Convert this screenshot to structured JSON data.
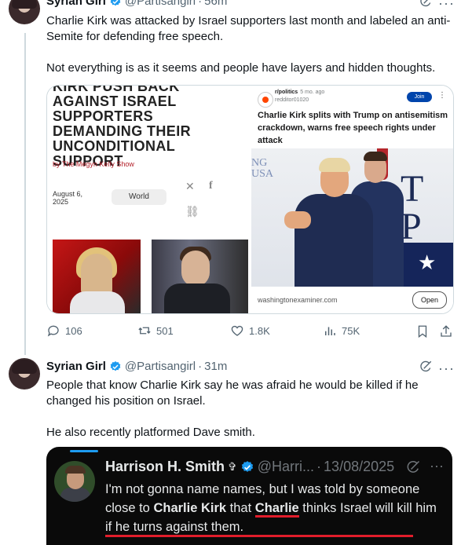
{
  "tweet1": {
    "name": "Syrian Girl",
    "handle": "@Partisangirl",
    "time": "56m",
    "text_line1": "Charlie Kirk was attacked by Israel supporters last month and labeled an anti-Semite for defending free speech.",
    "text_line2": "Not everything is as it seems and people have layers and hidden thoughts.",
    "media_left": {
      "headline": "KIRK PUSH BACK AGAINST ISRAEL SUPPORTERS DEMANDING THEIR UNCONDITIONAL SUPPORT",
      "byline": "by The Megyn Kelly Show",
      "date": "August 6, 2025",
      "tag": "World"
    },
    "media_right": {
      "subreddit": "r/politics",
      "age": "5 mo. ago",
      "poster": "redditor01020",
      "join": "Join",
      "title": "Charlie Kirk splits with Trump on antisemitism crackdown, warns free speech rights under attack",
      "watermark_left": "NG\nUSA",
      "watermark_right": "T\nP",
      "domain": "washingtonexaminer.com",
      "open": "Open"
    },
    "actions": {
      "replies": "106",
      "reposts": "501",
      "likes": "1.8K",
      "views": "75K"
    }
  },
  "tweet2": {
    "name": "Syrian Girl",
    "handle": "@Partisangirl",
    "time": "31m",
    "text_line1": "People that know Charlie Kirk say he was afraid he would be killed if he changed his position on Israel.",
    "text_line2": "He also recently platformed Dave smith.",
    "embed": {
      "name": "Harrison H. Smith",
      "cross": "✞",
      "handle": "@Harri...",
      "date": "13/08/2025",
      "text_a": "I'm not gonna name names, but I was told by someone close to ",
      "text_b": "Charlie Kirk",
      "text_c": " that ",
      "text_d": "Charlie",
      "text_e": " thinks Israel will kill him if he turns against them."
    }
  },
  "colors": {
    "verified": "#1d9bf0",
    "muted": "#536471",
    "underline": "#e11d2b",
    "join_button": "#0045ac"
  },
  "icons": [
    "verified-icon",
    "grok-icon",
    "more-icon",
    "reply-icon",
    "repost-icon",
    "like-icon",
    "views-icon",
    "bookmark-icon",
    "share-icon",
    "x-icon",
    "facebook-icon",
    "link-icon"
  ]
}
